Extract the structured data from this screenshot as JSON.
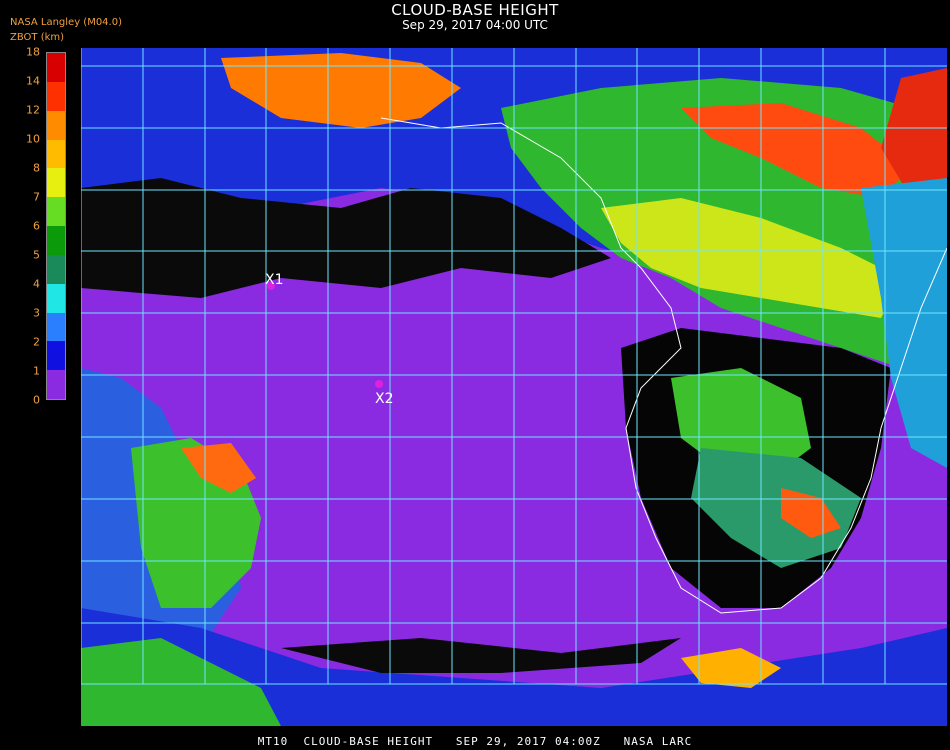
{
  "header": {
    "title": "CLOUD-BASE HEIGHT",
    "subtitle": "Sep 29, 2017 04:00 UTC",
    "org": "NASA Langley (M04.0)",
    "units": "ZBOT (km)"
  },
  "legend": {
    "ticks": [
      "0",
      "1",
      "2",
      "3",
      "4",
      "5",
      "6",
      "7",
      "8",
      "10",
      "12",
      "14",
      "18"
    ],
    "colors": [
      "#8a2be2",
      "#1010e0",
      "#2a7fff",
      "#20e6e6",
      "#1a8a5a",
      "#0a9a0a",
      "#66dd22",
      "#e6ef10",
      "#ffbb00",
      "#ff8c00",
      "#ff3000",
      "#d80000",
      "#7a0000"
    ]
  },
  "markers": [
    {
      "label": "X1",
      "color": "#e020e0"
    },
    {
      "label": "X2",
      "color": "#e020e0"
    }
  ],
  "map_colors": {
    "ocean": "#8a2be2",
    "grid": "#6fe6ff",
    "coast": "#ffffff",
    "no_cloud": "#000000"
  },
  "footer": "MT10  CLOUD-BASE HEIGHT   SEP 29, 2017 04:00Z   NASA LARC"
}
